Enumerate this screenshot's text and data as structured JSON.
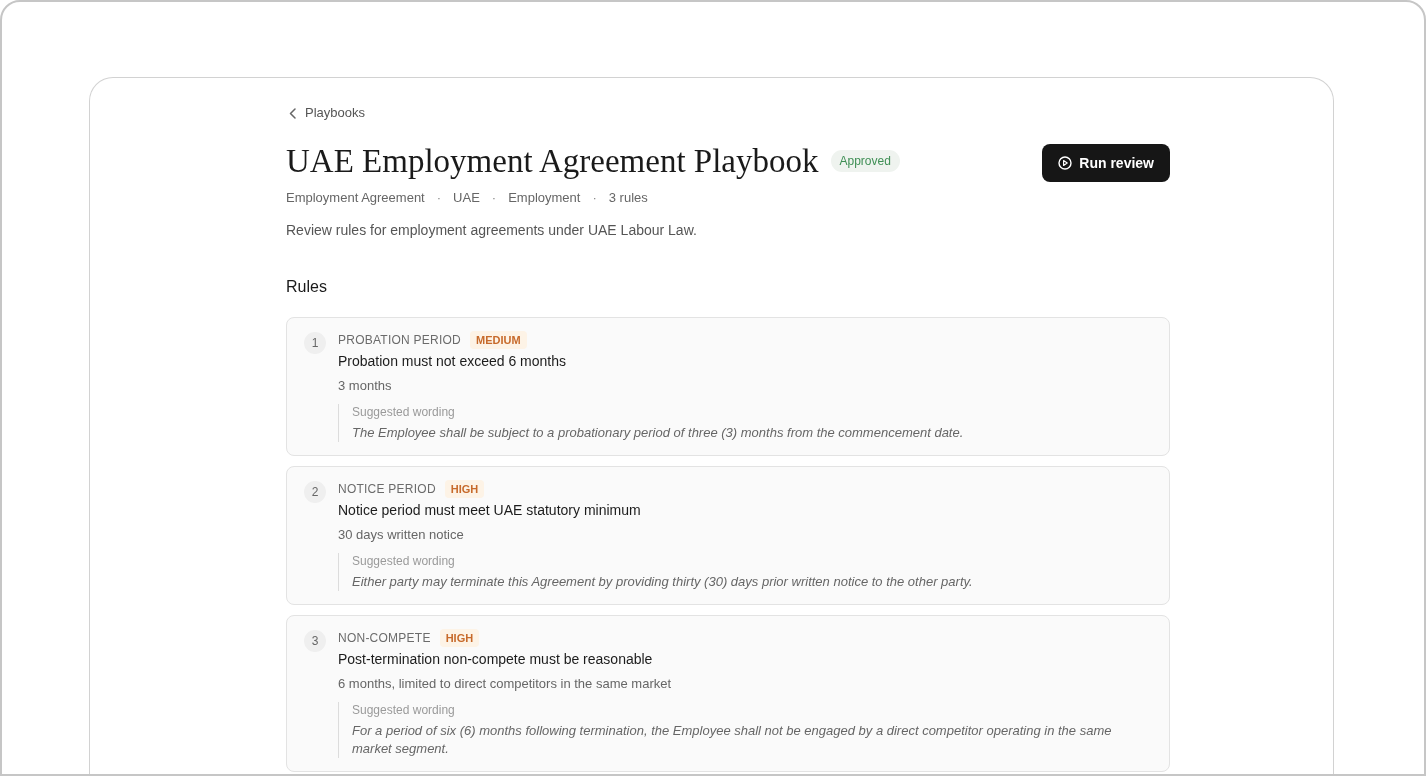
{
  "breadcrumb": {
    "label": "Playbooks"
  },
  "header": {
    "title": "UAE Employment Agreement Playbook",
    "status": "Approved",
    "meta": [
      {
        "kind": "text",
        "text": "Employment Agreement"
      },
      {
        "kind": "separator",
        "text": "·"
      },
      {
        "kind": "text",
        "text": "UAE"
      },
      {
        "kind": "separator",
        "text": "·"
      },
      {
        "kind": "text",
        "text": "Employment"
      },
      {
        "kind": "separator",
        "text": "·"
      },
      {
        "kind": "text",
        "text": "3 rules"
      }
    ],
    "description": "Review rules for employment agreements under UAE Labour Law.",
    "run_review_button": "Run review"
  },
  "rules_section": {
    "heading": "Rules",
    "rules": [
      {
        "number": "1",
        "category": "PROBATION PERIOD",
        "severity": "MEDIUM",
        "title": "Probation must not exceed 6 months",
        "value": "3 months",
        "suggestion_label": "Suggested wording",
        "suggestion": "The Employee shall be subject to a probationary period of three (3) months from the commencement date."
      },
      {
        "number": "2",
        "category": "NOTICE PERIOD",
        "severity": "HIGH",
        "title": "Notice period must meet UAE statutory minimum",
        "value": "30 days written notice",
        "suggestion_label": "Suggested wording",
        "suggestion": "Either party may terminate this Agreement by providing thirty (30) days prior written notice to the other party."
      },
      {
        "number": "3",
        "category": "NON-COMPETE",
        "severity": "HIGH",
        "title": "Post-termination non-compete must be reasonable",
        "value": "6 months, limited to direct competitors in the same market",
        "suggestion_label": "Suggested wording",
        "suggestion": "For a period of six (6) months following termination, the Employee shall not be engaged by a direct competitor operating in the same market segment."
      }
    ]
  }
}
